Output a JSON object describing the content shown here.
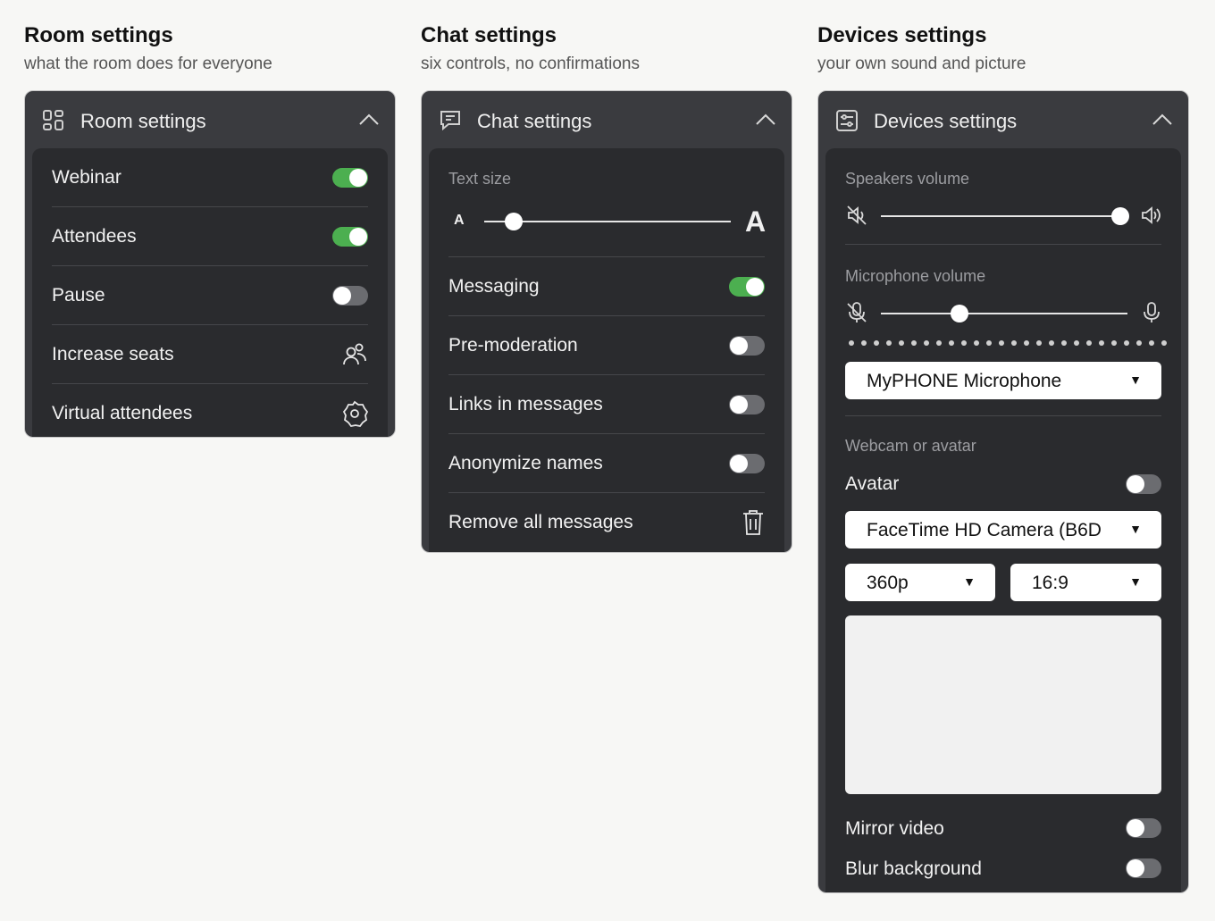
{
  "room": {
    "section_title": "Room settings",
    "section_subtitle": "what the room does for everyone",
    "panel_title": "Room settings",
    "header_icon": "grid-icon",
    "rows": [
      {
        "label": "Webinar",
        "control": "toggle",
        "on": true
      },
      {
        "label": "Attendees",
        "control": "toggle",
        "on": true
      },
      {
        "label": "Pause",
        "control": "toggle",
        "on": false
      },
      {
        "label": "Increase seats",
        "control": "icon",
        "icon": "people-icon"
      },
      {
        "label": "Virtual attendees",
        "control": "icon",
        "icon": "gear-badge-icon"
      }
    ]
  },
  "chat": {
    "section_title": "Chat settings",
    "section_subtitle": "six controls, no confirmations",
    "panel_title": "Chat settings",
    "header_icon": "chat-bubble-icon",
    "text_size": {
      "label": "Text size",
      "small_glyph": "A",
      "large_glyph": "A",
      "level": 0.12
    },
    "rows": [
      {
        "label": "Messaging",
        "control": "toggle",
        "on": true
      },
      {
        "label": "Pre-moderation",
        "control": "toggle",
        "on": false
      },
      {
        "label": "Links in messages",
        "control": "toggle",
        "on": false
      },
      {
        "label": "Anonymize names",
        "control": "toggle",
        "on": false
      },
      {
        "label": "Remove all messages",
        "control": "icon",
        "icon": "trash-icon"
      }
    ]
  },
  "devices": {
    "section_title": "Devices settings",
    "section_subtitle": "your own sound and picture",
    "panel_title": "Devices settings",
    "header_icon": "sliders-icon",
    "speakers": {
      "label": "Speakers volume",
      "level": 1.0
    },
    "microphone": {
      "label": "Microphone volume",
      "level": 0.32,
      "input_level": 0.0,
      "device": "MyPHONE Microphone"
    },
    "webcam": {
      "label": "Webcam or avatar",
      "avatar_label": "Avatar",
      "avatar_on": false,
      "camera": "FaceTime HD Camera (B6D",
      "resolution": "360p",
      "aspect": "16:9"
    },
    "mirror": {
      "label": "Mirror video",
      "on": false
    },
    "blur": {
      "label": "Blur background",
      "on": false
    }
  }
}
